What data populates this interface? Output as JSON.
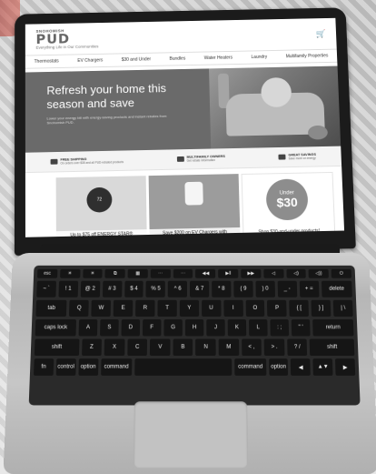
{
  "site": {
    "logo": {
      "top": "SNOHOMISH",
      "main": "PUD",
      "tagline": "Everything Life in Our Communities"
    },
    "nav": [
      "Thermostats",
      "EV Chargers",
      "$30 and Under",
      "Bundles",
      "Water Heaters",
      "Laundry",
      "Multifamily Properties"
    ],
    "hero": {
      "title_line1": "Refresh your home this",
      "title_line2": "season and save",
      "subtitle": "Lower your energy bill with energy-saving products and instant rebates from Snohomish PUD."
    },
    "benefits": [
      {
        "title": "FREE SHIPPING",
        "text": "On orders over $35 and all PUD-rebated products",
        "icon": "truck-icon"
      },
      {
        "title": "MULTIFAMILY OWNERS",
        "text": "Get rebate information",
        "icon": "building-icon"
      },
      {
        "title": "GREAT SAVINGS",
        "text": "Save more on energy",
        "icon": "piggy-bank-icon"
      }
    ],
    "cards": [
      {
        "caption": "Up to $75 off ENERGY STAR®",
        "thermostat_reading": "72"
      },
      {
        "caption": "Save $200 on EV Chargers with"
      },
      {
        "caption": "Shop $30-and-under products!",
        "badge_top": "Under",
        "badge_price": "$30"
      }
    ]
  },
  "keyboard": {
    "row0": [
      "esc",
      "☀",
      "☀",
      "⧉",
      "▦",
      "⋯",
      "⋯",
      "◀◀",
      "▶‖",
      "▶▶",
      "◁",
      "◁)",
      "◁))",
      "⏻"
    ],
    "row1": [
      "~ `",
      "! 1",
      "@ 2",
      "# 3",
      "$ 4",
      "% 5",
      "^ 6",
      "& 7",
      "* 8",
      "( 9",
      ") 0",
      "_ -",
      "+ =",
      "delete"
    ],
    "row2": [
      "tab",
      "Q",
      "W",
      "E",
      "R",
      "T",
      "Y",
      "U",
      "I",
      "O",
      "P",
      "{ [",
      "} ]",
      "| \\"
    ],
    "row3": [
      "caps lock",
      "A",
      "S",
      "D",
      "F",
      "G",
      "H",
      "J",
      "K",
      "L",
      ": ;",
      "\" '",
      "return"
    ],
    "row4": [
      "shift",
      "Z",
      "X",
      "C",
      "V",
      "B",
      "N",
      "M",
      "< ,",
      "> .",
      "? /",
      "shift"
    ],
    "row5": [
      "fn",
      "control",
      "option",
      "command",
      "",
      "command",
      "option",
      "◀",
      "▲▼",
      "▶"
    ]
  }
}
